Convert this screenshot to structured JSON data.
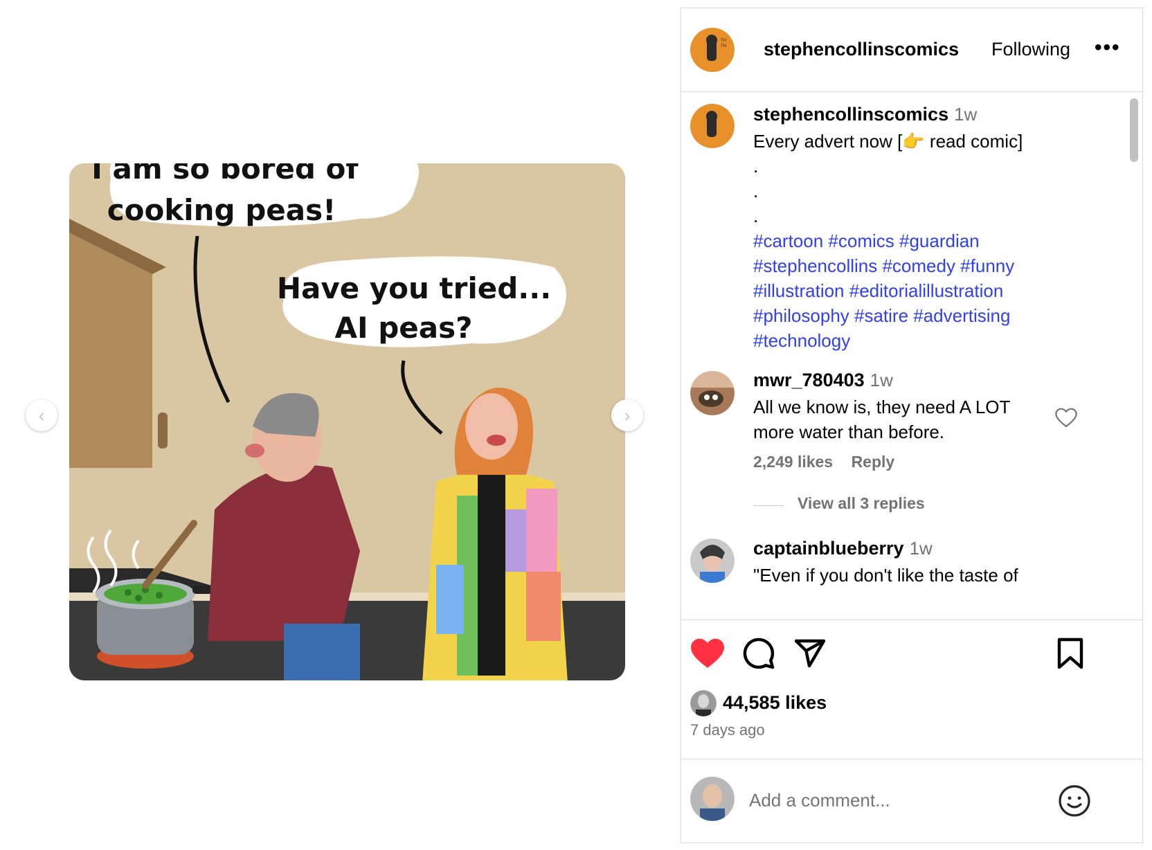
{
  "post": {
    "author": "stephencollinscomics",
    "follow_state": "Following",
    "more_label": "•••"
  },
  "comic": {
    "bubble1_line1": "I am so bored of",
    "bubble1_line2": "cooking peas!",
    "bubble2_line1": "Have you tried...",
    "bubble2_line2": "AI peas?"
  },
  "carousel": {
    "prev_icon": "‹",
    "next_icon": "›"
  },
  "caption": {
    "username": "stephencollinscomics",
    "time": "1w",
    "text_before": "Every advert now [",
    "emoji": "👉",
    "text_after": " read comic]",
    "dot": ".",
    "hashtag_lines": [
      "#cartoon #comics #guardian",
      "#stephencollins #comedy #funny",
      "#illustration #editorialillustration",
      "#philosophy #satire #advertising",
      "#technology"
    ]
  },
  "comments": [
    {
      "username": "mwr_780403",
      "time": "1w",
      "line1": "All we know is, they need A LOT",
      "line2": "more water than before.",
      "likes": "2,249 likes",
      "reply": "Reply",
      "view_replies": "View all 3 replies"
    },
    {
      "username": "captainblueberry",
      "time": "1w",
      "line1": "\"Even if you don't like the taste of"
    }
  ],
  "actions": {
    "likes": "44,585 likes",
    "posted": "7 days ago"
  },
  "add_comment": {
    "placeholder": "Add a comment..."
  },
  "colors": {
    "accent_link": "#3040f0",
    "like_red": "#ff3040",
    "muted": "#737373",
    "border": "#dbdbdb"
  }
}
